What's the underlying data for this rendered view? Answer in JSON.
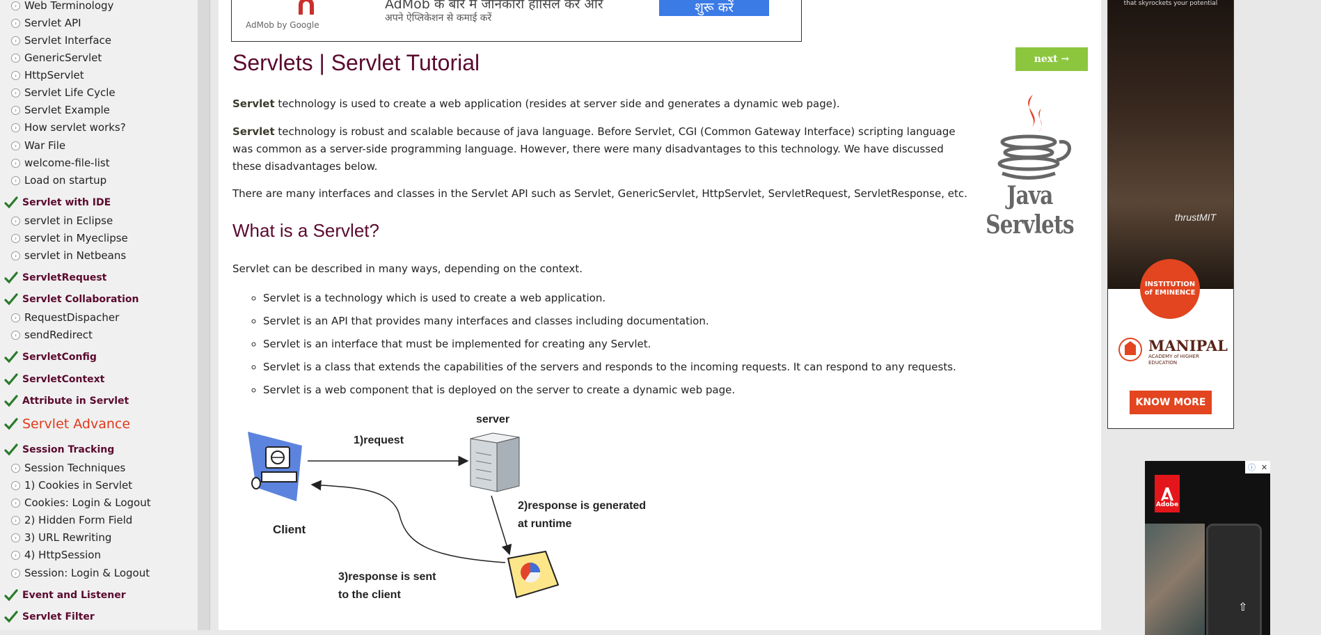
{
  "sidebar": {
    "items": [
      {
        "label": "Web Terminology",
        "kind": "sub"
      },
      {
        "label": "Servlet API",
        "kind": "sub"
      },
      {
        "label": "Servlet Interface",
        "kind": "sub"
      },
      {
        "label": "GenericServlet",
        "kind": "sub"
      },
      {
        "label": "HttpServlet",
        "kind": "sub"
      },
      {
        "label": "Servlet Life Cycle",
        "kind": "sub"
      },
      {
        "label": "Servlet Example",
        "kind": "sub"
      },
      {
        "label": "How servlet works?",
        "kind": "sub"
      },
      {
        "label": "War File",
        "kind": "sub"
      },
      {
        "label": "welcome-file-list",
        "kind": "sub"
      },
      {
        "label": "Load on startup",
        "kind": "sub"
      },
      {
        "label": "Servlet with IDE",
        "kind": "head"
      },
      {
        "label": "servlet in Eclipse",
        "kind": "sub"
      },
      {
        "label": "servlet in Myeclipse",
        "kind": "sub"
      },
      {
        "label": "servlet in Netbeans",
        "kind": "sub"
      },
      {
        "label": "ServletRequest",
        "kind": "head"
      },
      {
        "label": "Servlet Collaboration",
        "kind": "head"
      },
      {
        "label": "RequestDispacher",
        "kind": "sub"
      },
      {
        "label": "sendRedirect",
        "kind": "sub"
      },
      {
        "label": "ServletConfig",
        "kind": "head"
      },
      {
        "label": "ServletContext",
        "kind": "head"
      },
      {
        "label": "Attribute in Servlet",
        "kind": "head"
      },
      {
        "label": "Servlet Advance",
        "kind": "adv"
      },
      {
        "label": "Session Tracking",
        "kind": "head"
      },
      {
        "label": "Session Techniques",
        "kind": "sub"
      },
      {
        "label": "1) Cookies in Servlet",
        "kind": "sub"
      },
      {
        "label": "Cookies: Login & Logout",
        "kind": "sub"
      },
      {
        "label": "2) Hidden Form Field",
        "kind": "sub"
      },
      {
        "label": "3) URL Rewriting",
        "kind": "sub"
      },
      {
        "label": "4) HttpSession",
        "kind": "sub"
      },
      {
        "label": "Session: Login & Logout",
        "kind": "sub"
      },
      {
        "label": "Event and Listener",
        "kind": "head"
      },
      {
        "label": "Servlet Filter",
        "kind": "head"
      }
    ]
  },
  "top_ad": {
    "admob_label": "AdMob by Google",
    "text": "AdMob के बारे में जानकारी हासिल करें और",
    "text_line2": "अपने ऐप्लिकेशन से कमाई करें",
    "cta": "शुरू करें"
  },
  "next_button": "next →",
  "article": {
    "title": "Servlets | Servlet Tutorial",
    "p1_strong": "Servlet",
    "p1_rest": " technology is used to create a web application (resides at server side and generates a dynamic web page).",
    "p2_strong": "Servlet",
    "p2_rest": " technology is robust and scalable because of java language. Before Servlet, CGI (Common Gateway Interface) scripting language was common as a server-side programming language. However, there were many disadvantages to this technology. We have discussed these disadvantages below.",
    "p3": "There are many interfaces and classes in the Servlet API such as Servlet, GenericServlet, HttpServlet, ServletRequest, ServletResponse, etc.",
    "section_title": "What is a Servlet?",
    "p4": "Servlet can be described in many ways, depending on the context.",
    "bullets": [
      "Servlet is a technology which is used to create a web application.",
      "Servlet is an API that provides many interfaces and classes including documentation.",
      "Servlet is an interface that must be implemented for creating any Servlet.",
      "Servlet is a class that extends the capabilities of the servers and responds to the incoming requests. It can respond to any requests.",
      "Servlet is a web component that is deployed on the server to create a dynamic web page."
    ],
    "logo_text": "Java Servlets"
  },
  "diagram": {
    "server": "server",
    "request": "1)request",
    "client": "Client",
    "response_gen_1": "2)response is generated",
    "response_gen_2": "at runtime",
    "response_sent_1": "3)response is sent",
    "response_sent_2": "to the client"
  },
  "manipal_ad": {
    "tagline": "that skyrockets your potential",
    "thrust": "thrustMIT",
    "badge": "INSTITUTION of EMINENCE",
    "brand": "MANIPAL",
    "brand_sub": "ACADEMY of HIGHER EDUCATION",
    "cta": "KNOW MORE"
  },
  "adobe_ad": {
    "logo": "Adobe"
  },
  "colors": {
    "heading": "#5a0a2e",
    "next_button": "#8cc63f",
    "check": "#2a7a2a",
    "advance": "#e0391a"
  }
}
